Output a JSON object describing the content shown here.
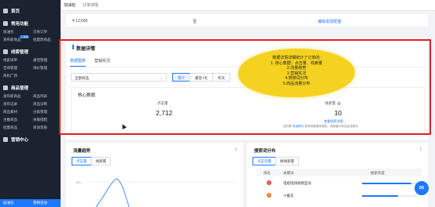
{
  "sidebar": {
    "sections": [
      {
        "title": "首页",
        "rows": []
      },
      {
        "title": "常用功能",
        "rows": [
          [
            "加油包",
            "交易订单"
          ],
          [
            "发布新商品",
            "批量改商品"
          ]
        ]
      },
      {
        "title": "线索管理",
        "rows": [
          [
            "线索详单",
            "通话管理"
          ],
          [
            "咨询管理",
            "询价管理"
          ],
          [
            "商机广场",
            ""
          ]
        ]
      },
      {
        "title": "商品管理",
        "rows": [
          [
            "发布新商品",
            "商品列表"
          ],
          [
            "发布记录",
            "商品诊断"
          ],
          [
            "商品素材",
            "分类管理"
          ],
          [
            "主推商品",
            "关联搭配"
          ],
          [
            "批量商品",
            "商详资质"
          ]
        ]
      },
      {
        "title": "营销中心",
        "rows": []
      }
    ],
    "badge": "工具箱",
    "active_row": [
      "加油包",
      "营销活动"
    ]
  },
  "topbar": {
    "crumb1": "加油包",
    "crumb2": "订单详情"
  },
  "top_table": {
    "price": "¥ 12,600",
    "flag": "否",
    "link": "编辑发放配置"
  },
  "panel": {
    "title": "数据详情",
    "tabs": [
      "数据图表",
      "营销实况"
    ],
    "filter": {
      "value": "全部商品",
      "chev": "⌄"
    },
    "ranges": [
      "累计",
      "最近7天",
      "昨天"
    ],
    "core": {
      "title": "核心数据",
      "m1_label": "点击量",
      "m1_value": "2,712",
      "m2_label": "线索量",
      "m2_value": "10",
      "m2_link": "查看线索详情",
      "note_a": "四月是 ",
      "note_link": "电话助手",
      "note_b": " 咨询线索是线索的，线索量中未包含该部分"
    }
  },
  "sticky": {
    "lines": [
      "数据详情详细统计了订单的:",
      "1. 核心数据：点击量、线索量",
      "2.流量趋势",
      "3.营销实况",
      "4.搜搜词分布",
      "5.商品流量分布"
    ]
  },
  "trend": {
    "title": "流量趋势",
    "tabs": [
      "点击量",
      "线索量"
    ],
    "ytick": "100"
  },
  "search": {
    "title": "搜索词分布",
    "tabs": [
      "点击流量",
      "搜线索量"
    ],
    "headers": [
      "排名",
      "关键词",
      "搜索热度"
    ],
    "rows": [
      {
        "rank": "1",
        "keyword": "电缆电线规格型号",
        "heat": 0.9
      },
      {
        "rank": "2",
        "keyword": "小推车",
        "heat": 0.65
      }
    ]
  },
  "icons": {
    "download": "⤓",
    "chat": "✉"
  }
}
